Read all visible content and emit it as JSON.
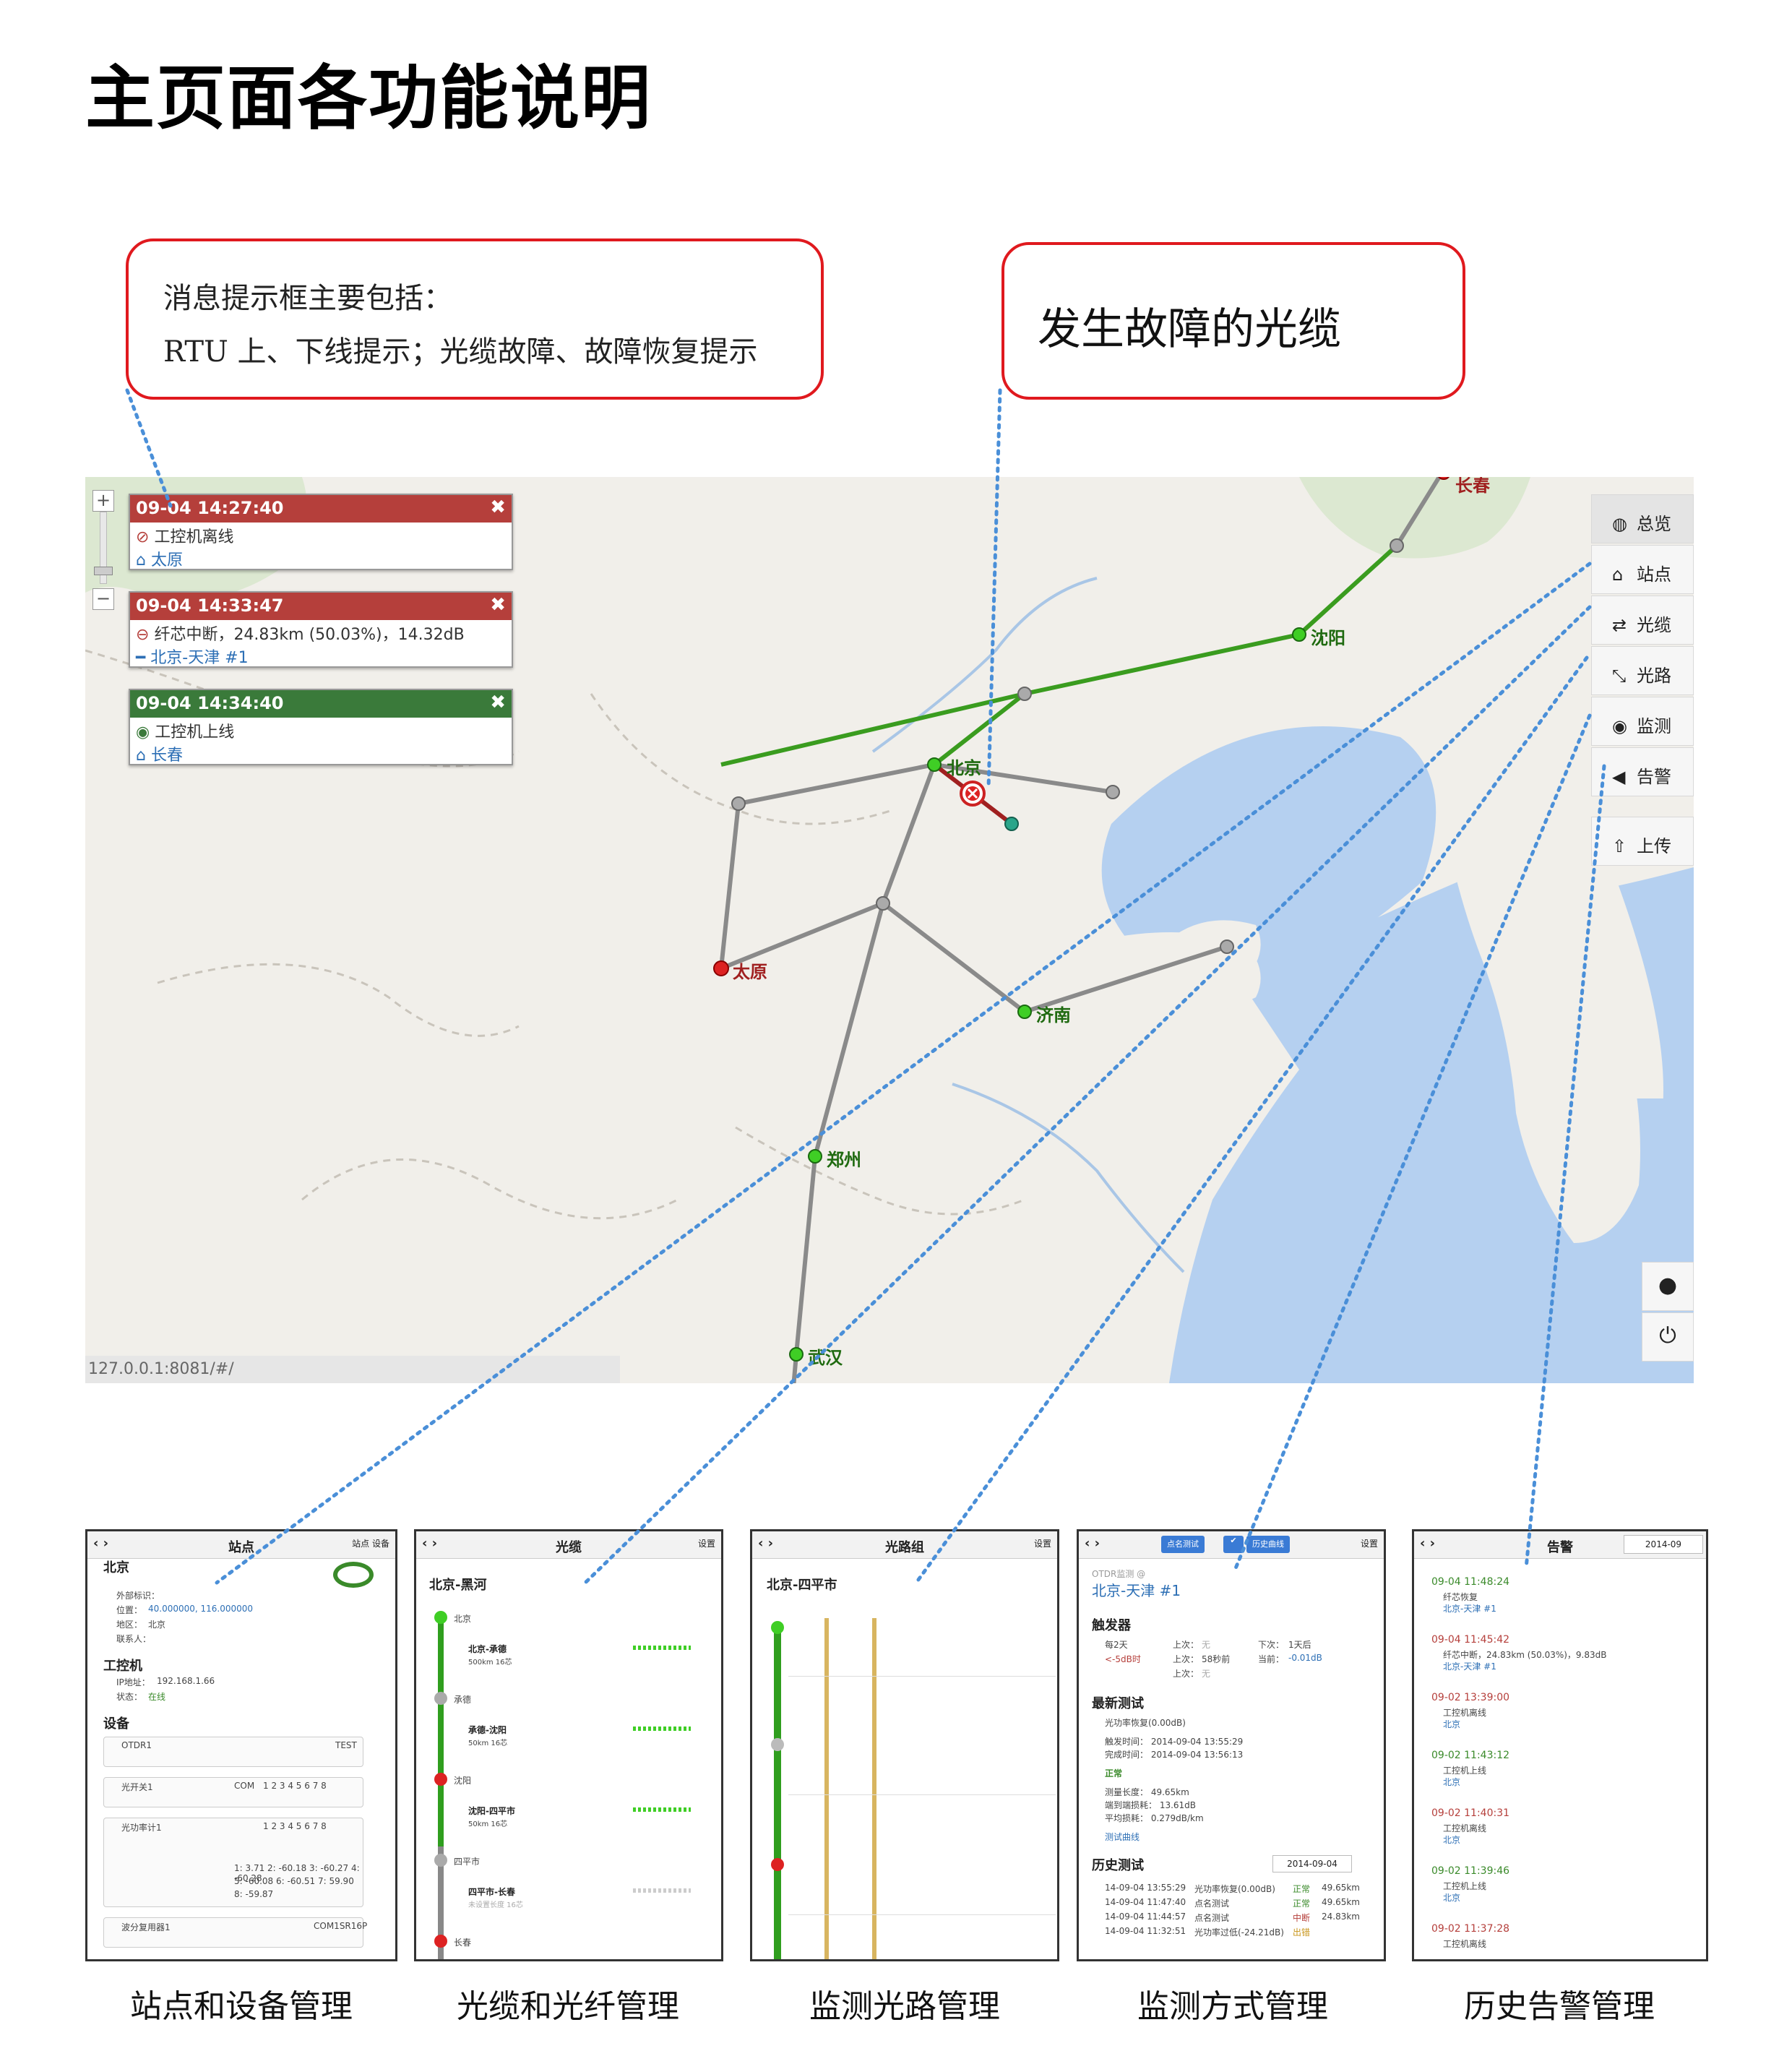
{
  "title": "主页面各功能说明",
  "callout_messages": {
    "line1": "消息提示框主要包括：",
    "line2": "RTU 上、下线提示；光缆故障、故障恢复提示"
  },
  "callout_fault": "发生故障的光缆",
  "map": {
    "toasts": [
      {
        "time": "09-04 14:27:40",
        "line1": "工控机离线",
        "line2": "太原",
        "color": "#b53f3b"
      },
      {
        "time": "09-04 14:33:47",
        "line1": "纤芯中断，24.83km (50.03%)，14.32dB",
        "line2": "北京-天津 #1",
        "color": "#b53f3b"
      },
      {
        "time": "09-04 14:34:40",
        "line1": "工控机上线",
        "line2": "长春",
        "color": "#3a7a3a"
      }
    ],
    "close_glyph": "✖",
    "zoom_in": "+",
    "zoom_out": "−",
    "cities": {
      "changchun": "长春",
      "shenyang": "沈阳",
      "beijing": "北京",
      "taiyuan": "太原",
      "jinan": "济南",
      "zhengzhou": "郑州",
      "wuhan": "武汉"
    },
    "nav": [
      "总览",
      "站点",
      "光缆",
      "光路",
      "监测",
      "告警"
    ],
    "upload": "上传",
    "status_url": "127.0.0.1:8081/#/",
    "colors": {
      "sea": "#b5d0f0",
      "land": "#f1efea",
      "green_line": "#3a9c1f",
      "gray_line": "#8a8a8a",
      "fault_line": "#a02020"
    }
  },
  "panels": {
    "station": {
      "nav": "‹ ›",
      "title": "站点",
      "tools": "站点  设备",
      "name": "北京",
      "ext_label": "外部标识：",
      "pos_label": "位置：",
      "pos_value": "40.000000, 116.000000",
      "region_label": "地区：",
      "region_value": "北京",
      "contact_label": "联系人：",
      "ipc_heading": "工控机",
      "ip_label": "IP地址：",
      "ip_value": "192.168.1.66",
      "state_label": "状态：",
      "state_value": "在线",
      "dev_heading": "设备",
      "devices": [
        "OTDR1",
        "光开关1",
        "光功率计1",
        "波分复用器1"
      ],
      "otdr_badge": "TEST",
      "switch_com": "COM",
      "ports": "1  2  3  4  5  6  7  8",
      "power_values": [
        "1: 3.71   2: -60.18   3: -60.27   4: -60.28",
        "5: -60.08   6: -60.51   7: 59.90",
        "8: -59.87"
      ],
      "wdm_com": "COM1SR16P"
    },
    "cable": {
      "nav": "‹ ›",
      "title": "光缆",
      "tools": "设置",
      "group": "北京-黑河",
      "stations": [
        "北京",
        "承德",
        "沈阳",
        "四平市",
        "长春"
      ],
      "segments": [
        {
          "name": "北京-承德",
          "spec": "500km 16芯"
        },
        {
          "name": "承德-沈阳",
          "spec": "50km 16芯"
        },
        {
          "name": "沈阳-四平市",
          "spec": "50km 16芯"
        },
        {
          "name": "四平市-长春",
          "spec": "未设置长度 16芯"
        }
      ]
    },
    "route": {
      "nav": "‹ ›",
      "title": "光路组",
      "tools": "设置",
      "group": "北京-四平市"
    },
    "monitor": {
      "nav": "‹ ›",
      "btn1": "点名测试",
      "btn3": "历史曲线",
      "tools": "设置",
      "sub": "OTDR监测 @",
      "route_name": "北京-天津 #1",
      "trigger_heading": "触发器",
      "every": "每2天",
      "last_label": "上次：",
      "last_value": "无",
      "next_label": "下次：",
      "next_value": "1天后",
      "threshold": "<-5dB时",
      "last2_value": "58秒前",
      "current_label": "当前：",
      "current_value": "-0.01dB",
      "latest_heading": "最新测试",
      "latest_item": "光功率恢复(0.00dB)",
      "trig_time": "触发时间：  2014-09-04 13:55:29",
      "done_time": "完成时间：  2014-09-04 13:56:13",
      "ok": "正常",
      "len": "测量长度：  49.65km",
      "loss1": "端到端损耗：  13.61dB",
      "loss2": "平均损耗：  0.279dB/km",
      "curve_link": "测试曲线",
      "history_heading": "历史测试",
      "date": "2014-09-04",
      "history": [
        {
          "t": "14-09-04 13:55:29",
          "what": "光功率恢复(0.00dB)",
          "st": "正常",
          "len": "49.65km"
        },
        {
          "t": "14-09-04 11:47:40",
          "what": "点名测试",
          "st": "正常",
          "len": "49.65km"
        },
        {
          "t": "14-09-04 11:44:57",
          "what": "点名测试",
          "st": "中断",
          "len": "24.83km"
        },
        {
          "t": "14-09-04 11:32:51",
          "what": "光功率过低(-24.21dB)",
          "st": "出错",
          "len": ""
        }
      ]
    },
    "alarm": {
      "nav": "‹ ›",
      "title": "告警",
      "month": "2014-09",
      "items": [
        {
          "time": "09-04 11:48:24",
          "what": "纤芯恢复",
          "where": "北京-天津 #1",
          "color": "#3a8a2a"
        },
        {
          "time": "09-04 11:45:42",
          "what": "纤芯中断，24.83km (50.03%)，9.83dB",
          "where": "北京-天津 #1",
          "color": "#b53f3b"
        },
        {
          "time": "09-02 13:39:00",
          "what": "工控机离线",
          "where": "北京",
          "color": "#b53f3b"
        },
        {
          "time": "09-02 11:43:12",
          "what": "工控机上线",
          "where": "北京",
          "color": "#3a8a2a"
        },
        {
          "time": "09-02 11:40:31",
          "what": "工控机离线",
          "where": "北京",
          "color": "#b53f3b"
        },
        {
          "time": "09-02 11:39:46",
          "what": "工控机上线",
          "where": "北京",
          "color": "#3a8a2a"
        },
        {
          "time": "09-02 11:37:28",
          "what": "工控机离线",
          "where": "",
          "color": "#b53f3b"
        }
      ]
    }
  },
  "captions": [
    "站点和设备管理",
    "光缆和光纤管理",
    "监测光路管理",
    "监测方式管理",
    "历史告警管理"
  ]
}
